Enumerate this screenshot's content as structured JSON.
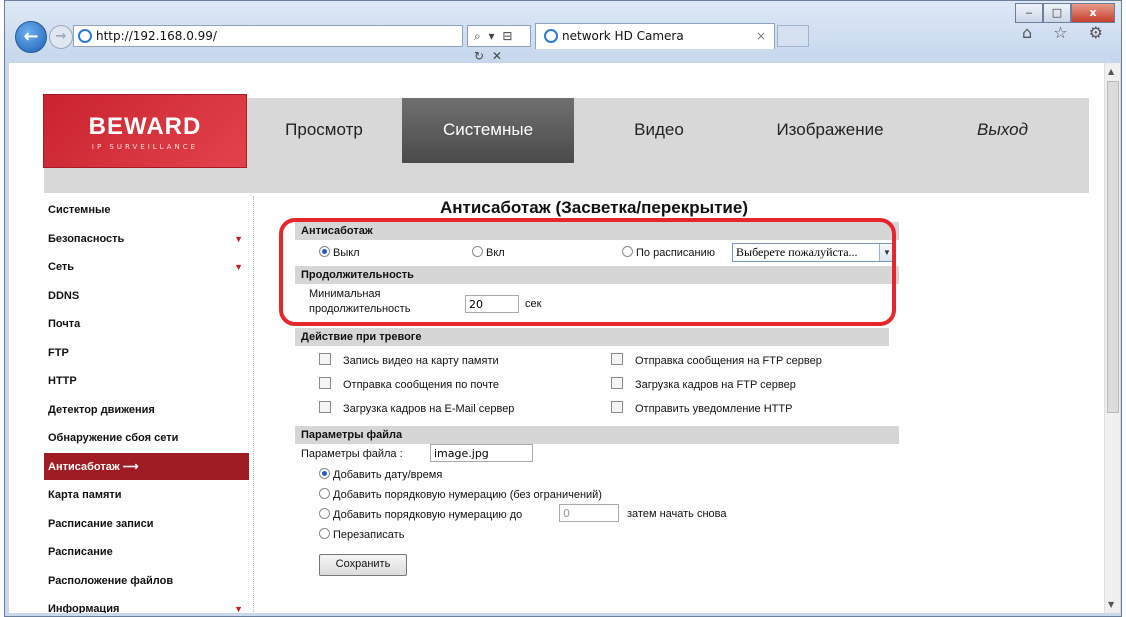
{
  "browser": {
    "url": "http://192.168.0.99/",
    "address_controls": "⌕ ▾ ⊟ ↻ ✕",
    "tab_title": "network HD Camera",
    "tab_close": "×",
    "window_buttons": [
      "‒",
      "□",
      "x"
    ],
    "tool_icons": "⌂ ☆ ⚙"
  },
  "header": {
    "logo": "BEWARD",
    "logo_sub": "IP SURVEILLANCE",
    "menu": [
      "Просмотр",
      "Системные",
      "Видео",
      "Изображение",
      "Выход"
    ],
    "active_menu": "Системные"
  },
  "sidebar": {
    "items": [
      {
        "label": "Системные",
        "caret": ""
      },
      {
        "label": "Безопасность",
        "caret": "▼"
      },
      {
        "label": "Сеть",
        "caret": "▼"
      },
      {
        "label": "DDNS",
        "caret": ""
      },
      {
        "label": "Почта",
        "caret": ""
      },
      {
        "label": "FTP",
        "caret": ""
      },
      {
        "label": "HTTP",
        "caret": ""
      },
      {
        "label": "Детектор движения",
        "caret": ""
      },
      {
        "label": "Обнаружение сбоя сети",
        "caret": ""
      },
      {
        "label": "Антисаботаж ⟶",
        "caret": ""
      },
      {
        "label": "Карта памяти",
        "caret": ""
      },
      {
        "label": "Расписание записи",
        "caret": ""
      },
      {
        "label": "Расписание",
        "caret": ""
      },
      {
        "label": "Расположение файлов",
        "caret": ""
      },
      {
        "label": "Информация",
        "caret": "▼"
      }
    ],
    "active_index": 9
  },
  "page": {
    "title": "Антисаботаж (Засветка/перекрытие)",
    "antisabotage": {
      "section": "Антисаботаж",
      "off": "Выкл",
      "on": "Вкл",
      "schedule": "По расписанию",
      "schedule_select": "Выберете пожалуйста...",
      "selected": "off"
    },
    "duration": {
      "section": "Продолжительность",
      "label_line1": "Минимальная",
      "label_line2": "продолжительность",
      "value": "20",
      "unit": "сек"
    },
    "alarm": {
      "section": "Действие при тревоге",
      "left": [
        "Запись видео на карту памяти",
        "Отправка сообщения по почте",
        "Загрузка кадров на E-Mail сервер"
      ],
      "right": [
        "Отправка сообщения на FTP сервер",
        "Загрузка кадров на FTP сервер",
        "Отправить уведомление HTTP"
      ]
    },
    "file": {
      "section": "Параметры файла",
      "name_label": "Параметры файла :",
      "name_value": "image.jpg",
      "options": [
        "Добавить дату/время",
        "Добавить порядковую нумерацию (без ограничений)",
        "Добавить порядковую нумерацию до",
        "Перезаписать"
      ],
      "counter_value": "0",
      "counter_suffix": "затем начать снова",
      "selected_index": 0
    },
    "save_button": "Сохранить"
  },
  "colors": {
    "accent_red": "#a01c24",
    "logo_red": "#d12f38",
    "highlight": "#e5262c"
  }
}
